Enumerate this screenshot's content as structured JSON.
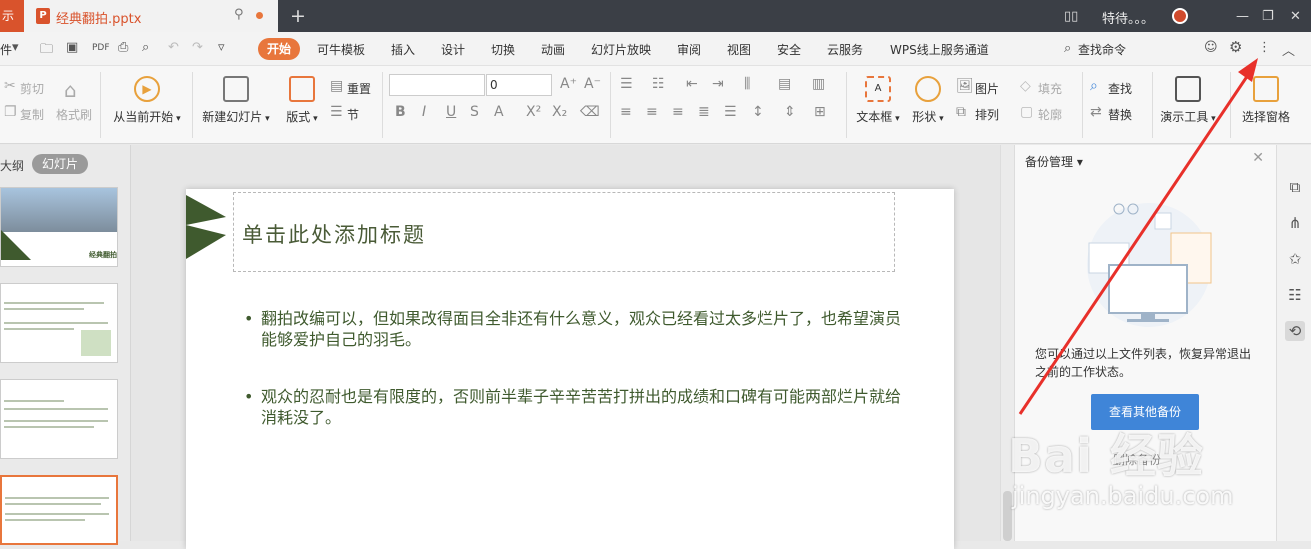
{
  "titlebar": {
    "left_stub": "示",
    "doc_tab_name": "经典翻拍.pptx",
    "user_name": "特待。。。"
  },
  "menu": {
    "left_stub": "件",
    "tabs": [
      "开始",
      "可牛模板",
      "插入",
      "设计",
      "切换",
      "动画",
      "幻灯片放映",
      "审阅",
      "视图",
      "安全",
      "云服务",
      "WPS线上服务通道"
    ],
    "search_label": "查找命令"
  },
  "ribbon": {
    "cut": "剪切",
    "copy": "复制",
    "format_painter": "格式刷",
    "from_current": "从当前开始",
    "new_slide": "新建幻灯片",
    "layout": "版式",
    "reset": "重置",
    "section": "节",
    "font_size": "0",
    "textbox": "文本框",
    "shape": "形状",
    "picture": "图片",
    "arrange": "排列",
    "fill": "填充",
    "outline": "轮廓",
    "find": "查找",
    "replace": "替换",
    "presenter_tools": "演示工具",
    "selection_pane": "选择窗格"
  },
  "leftpane": {
    "outline_tab": "大纲",
    "slides_tab": "幻灯片",
    "thumb1_label": "经典翻拍"
  },
  "slide": {
    "title_placeholder": "单击此处添加标题",
    "bullets": [
      "翻拍改编可以，但如果改得面目全非还有什么意义，观众已经看过太多烂片了，也希望演员能够爱护自己的羽毛。",
      "观众的忍耐也是有限度的，否则前半辈子辛辛苦苦打拼出的成绩和口碑有可能两部烂片就给消耗没了。"
    ]
  },
  "backup_panel": {
    "title": "备份管理",
    "description": "您可以通过以上文件列表，恢复异常退出之前的工作状态。",
    "button": "查看其他备份",
    "link": "删除备份"
  },
  "watermark": {
    "brand": "Bai 经验",
    "url": "jingyan.baidu.com"
  },
  "colors": {
    "accent": "#e8763c",
    "titlebar": "#3b3f46",
    "slide_text": "#3f5a2e",
    "button_blue": "#3f85d8",
    "annotation_arrow": "#e8302a"
  }
}
